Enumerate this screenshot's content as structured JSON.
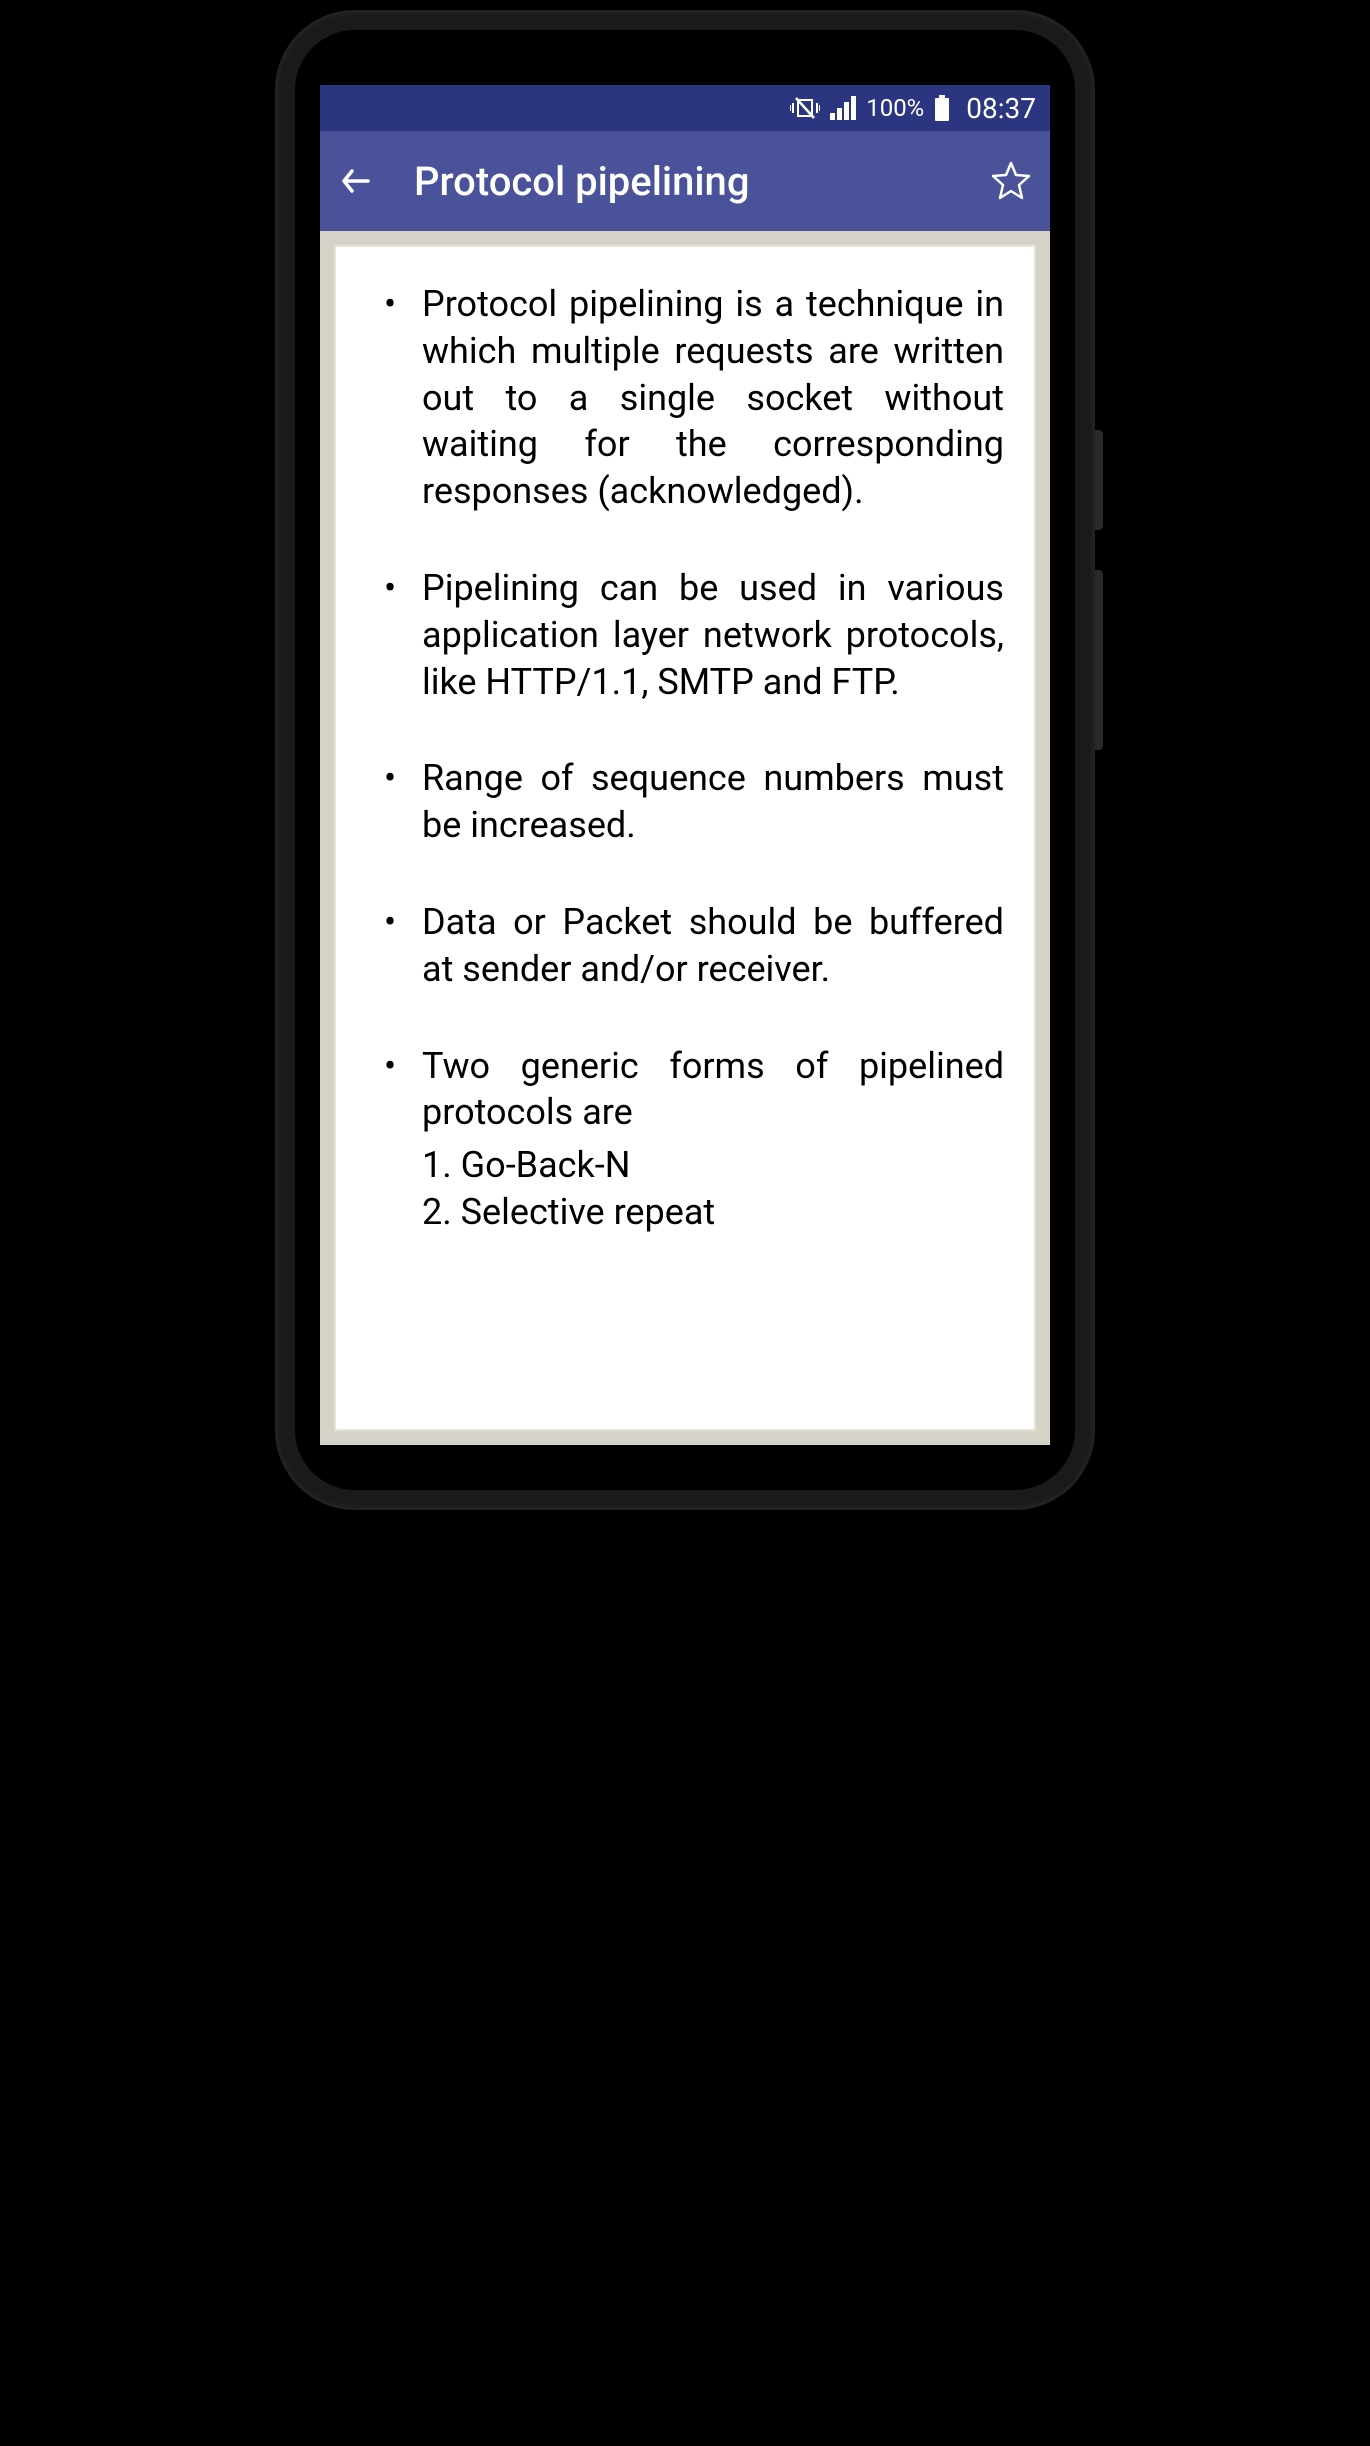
{
  "status_bar": {
    "vibrate_muted_icon": "vibrate-muted",
    "signal_icon": "cellular-signal",
    "battery_percent": "100%",
    "battery_icon": "battery-full",
    "time": "08:37"
  },
  "app_bar": {
    "back_icon": "arrow-back",
    "title": "Protocol pipelining",
    "star_icon": "star-outline"
  },
  "content": {
    "bullets": [
      {
        "text": "Protocol pipelining is a technique in which multiple requests are written out to a single socket without waiting for the corresponding responses (acknowledged)."
      },
      {
        "text": "Pipelining can be used in various application layer network protocols, like HTTP/1.1, SMTP and FTP."
      },
      {
        "text": "Range of sequence numbers must be increased."
      },
      {
        "text": "Data or Packet should be buffered at sender and/or receiver."
      },
      {
        "text": "Two generic forms of pipelined protocols are",
        "subs": [
          "1. Go-Back-N",
          "2. Selective repeat"
        ]
      }
    ]
  }
}
